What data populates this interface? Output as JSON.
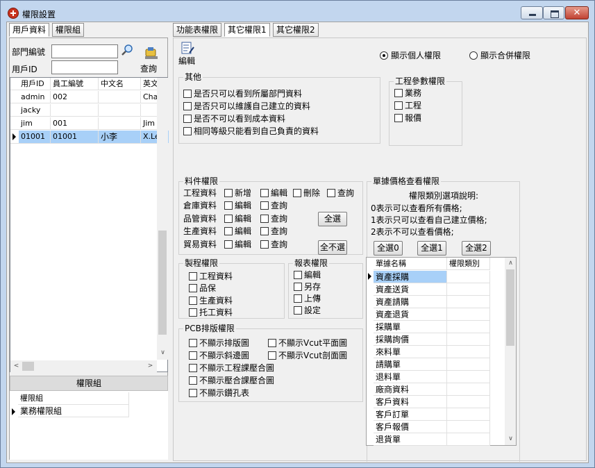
{
  "window": {
    "title": "權限設置"
  },
  "left_tabs": [
    "用戶資料",
    "權限組"
  ],
  "right_tabs": [
    "功能表權限",
    "其它權限1",
    "其它權限2"
  ],
  "search": {
    "dept_label": "部門編號",
    "user_label": "用戶ID",
    "query_label": "查詢",
    "dept_value": "",
    "user_value": ""
  },
  "user_grid": {
    "columns": [
      "用戶ID",
      "員工編號",
      "中文名",
      "英文"
    ],
    "rows": [
      [
        "admin",
        "002",
        "",
        "Cha"
      ],
      [
        "jacky",
        "",
        "",
        ""
      ],
      [
        "jim",
        "001",
        "",
        "Jim"
      ],
      [
        "01001",
        "01001",
        "小李",
        "X.Le"
      ]
    ]
  },
  "group_panel": {
    "header": "權限組",
    "column": "權限組",
    "rows": [
      "業務權限組"
    ]
  },
  "toolbar": {
    "edit_label": "編輯"
  },
  "radios": {
    "personal": "顯示個人權限",
    "merged": "顯示合併權限"
  },
  "other_group": {
    "title": "其他",
    "items": [
      "是否只可以看到所屬部門資料",
      "是否只可以維護自己建立的資料",
      "是否不可以看到成本資料",
      "相同等級只能看到自己負責的資料"
    ]
  },
  "engineering_group": {
    "title": "工程參數權限",
    "items": [
      "業務",
      "工程",
      "報價"
    ]
  },
  "material_group": {
    "title": "料件權限",
    "rows": [
      {
        "label": "工程資料",
        "items": [
          "新增",
          "編輯",
          "刪除",
          "查詢"
        ]
      },
      {
        "label": "倉庫資料",
        "items": [
          "編輯",
          "查詢"
        ]
      },
      {
        "label": "品管資料",
        "items": [
          "編輯",
          "查詢"
        ]
      },
      {
        "label": "生產資料",
        "items": [
          "編輯",
          "查詢"
        ]
      },
      {
        "label": "貿易資料",
        "items": [
          "編輯",
          "查詢"
        ]
      }
    ],
    "select_all": "全選",
    "select_none": "全不選"
  },
  "process_group": {
    "title": "製程權限",
    "items": [
      "工程資料",
      "品保",
      "生產資料",
      "托工資料"
    ]
  },
  "report_group": {
    "title": "報表權限",
    "items": [
      "編輯",
      "另存",
      "上傳",
      "設定"
    ]
  },
  "pcb_group": {
    "title": "PCB排版權限",
    "items": [
      "不顯示排版圖",
      "不顯示Vcut平面圖",
      "不顯示斜邊圖",
      "不顯示Vcut剖面圖",
      "不顯示工程課壓合圖",
      "不顯示壓合課壓合圖",
      "不顯示鑽孔表"
    ]
  },
  "price_group": {
    "title": "單據價格查看權限",
    "desc_title": "權限類別選項說明:",
    "desc": [
      "0表示可以查看所有價格;",
      "1表示只可以查看自己建立價格;",
      "2表示不可以查看價格;"
    ],
    "buttons": [
      "全選0",
      "全選1",
      "全選2"
    ],
    "columns": [
      "單據名稱",
      "權限類別"
    ],
    "rows": [
      "資產採購",
      "資產送貨",
      "資產請購",
      "資產退貨",
      "採購單",
      "採購詢價",
      "來料單",
      "請購單",
      "退料單",
      "廠商資料",
      "客戶資料",
      "客戶訂單",
      "客戶報價",
      "退貨單"
    ]
  }
}
